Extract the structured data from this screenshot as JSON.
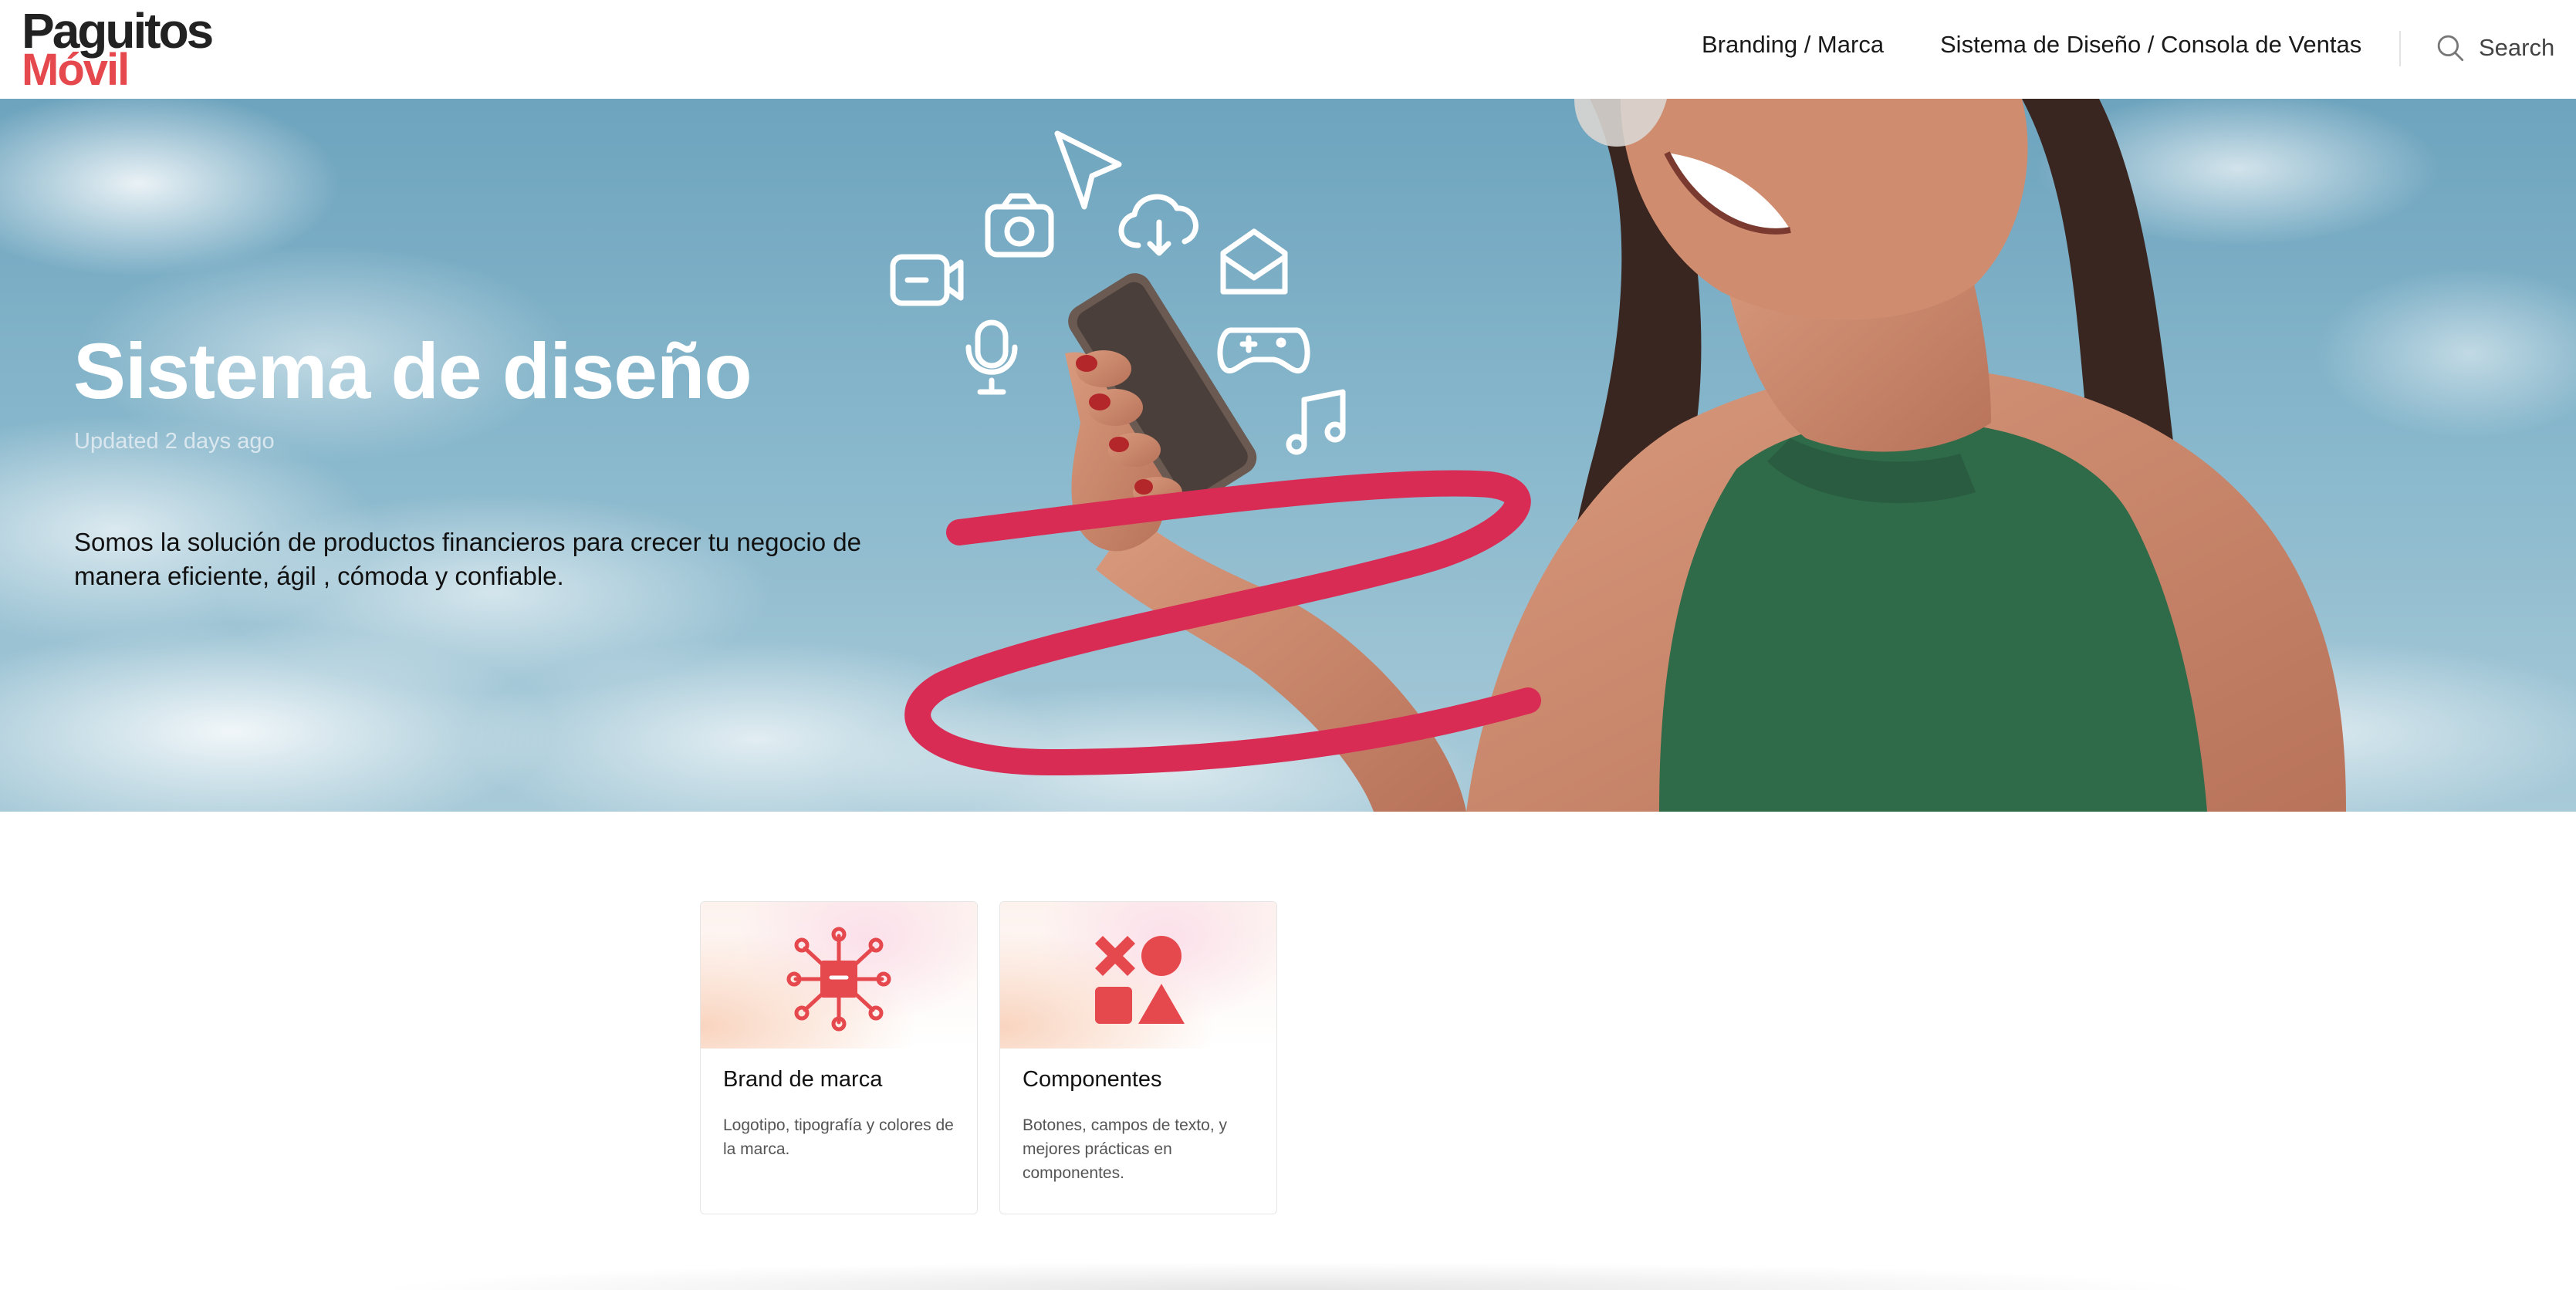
{
  "header": {
    "logo_line1": "Paguitos",
    "logo_line2": "Móvil",
    "nav": [
      {
        "label": "Branding / Marca"
      },
      {
        "label": "Sistema de Diseño / Consola de Ventas"
      }
    ],
    "search_label": "Search"
  },
  "hero": {
    "title": "Sistema de diseño",
    "updated": "Updated 2 days ago",
    "description": "Somos la solución de productos financieros para crecer tu negocio de manera eficiente, ágil , cómoda y confiable."
  },
  "cards": [
    {
      "title": "Brand de marca",
      "description": "Logotipo, tipografía y colores de la marca.",
      "icon": "brand-network-icon"
    },
    {
      "title": "Componentes",
      "description": "Botones, campos de texto, y mejores prácticas en componentes.",
      "icon": "shapes-icon"
    }
  ],
  "colors": {
    "brand_red": "#e6494d",
    "ribbon_red": "#d92c54",
    "text_dark": "#111111"
  }
}
